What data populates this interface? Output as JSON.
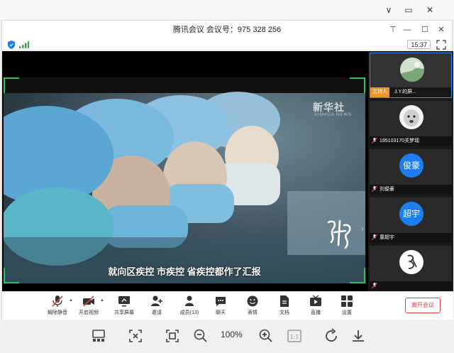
{
  "window": {
    "minimize_glyph": "∨",
    "restore_glyph": "▭",
    "close_glyph": "✕"
  },
  "meeting": {
    "title": "腾讯会议  会议号：975 328 256",
    "time": "15:37",
    "window_controls": {
      "pin": "⊤",
      "minimize": "—",
      "maximize": "☐",
      "close": "✕"
    }
  },
  "video": {
    "watermark": "新华社",
    "watermark_sub": "XINHUA NEWS",
    "subtitle": "就向区疾控  市疾控  省疾控都作了汇报"
  },
  "participants": [
    {
      "name": "J.Y.的屏...",
      "host_badge": "主持人",
      "avatar": "landscape-avatar",
      "active": true
    },
    {
      "name": "195103170关梦瑶",
      "avatar": "alpaca-avatar",
      "active": false
    },
    {
      "name": "刘俊豪",
      "avatar_text": "俊豪",
      "active": false
    },
    {
      "name": "童超宇",
      "avatar_text": "超宇",
      "active": false
    },
    {
      "name": "",
      "avatar": "logo-avatar",
      "active": false
    }
  ],
  "toolbar": {
    "items": [
      {
        "label": "解除静音",
        "icon": "mic-muted-icon"
      },
      {
        "label": "开启视频",
        "icon": "camera-off-icon"
      },
      {
        "label": "共享屏幕",
        "icon": "share-screen-icon"
      },
      {
        "label": "邀请",
        "icon": "invite-icon"
      },
      {
        "label": "成员(13)",
        "icon": "members-icon"
      },
      {
        "label": "聊天",
        "icon": "chat-icon"
      },
      {
        "label": "表情",
        "icon": "emoji-icon"
      },
      {
        "label": "文档",
        "icon": "document-icon"
      },
      {
        "label": "直播",
        "icon": "live-icon"
      },
      {
        "label": "设置",
        "icon": "settings-icon"
      }
    ],
    "leave_label": "离开会议"
  },
  "viewer": {
    "zoom": "100%",
    "icons": [
      "thumbnail-icon",
      "fit-icon",
      "actual-size-icon",
      "zoom-out-icon",
      "zoom-in-icon",
      "one-to-one-icon",
      "rotate-icon",
      "download-icon"
    ]
  },
  "colors": {
    "accent_blue": "#1e7ef0",
    "host_orange": "#e8962e",
    "leave_red": "#e04040",
    "video_frame_green": "#29c26a"
  }
}
